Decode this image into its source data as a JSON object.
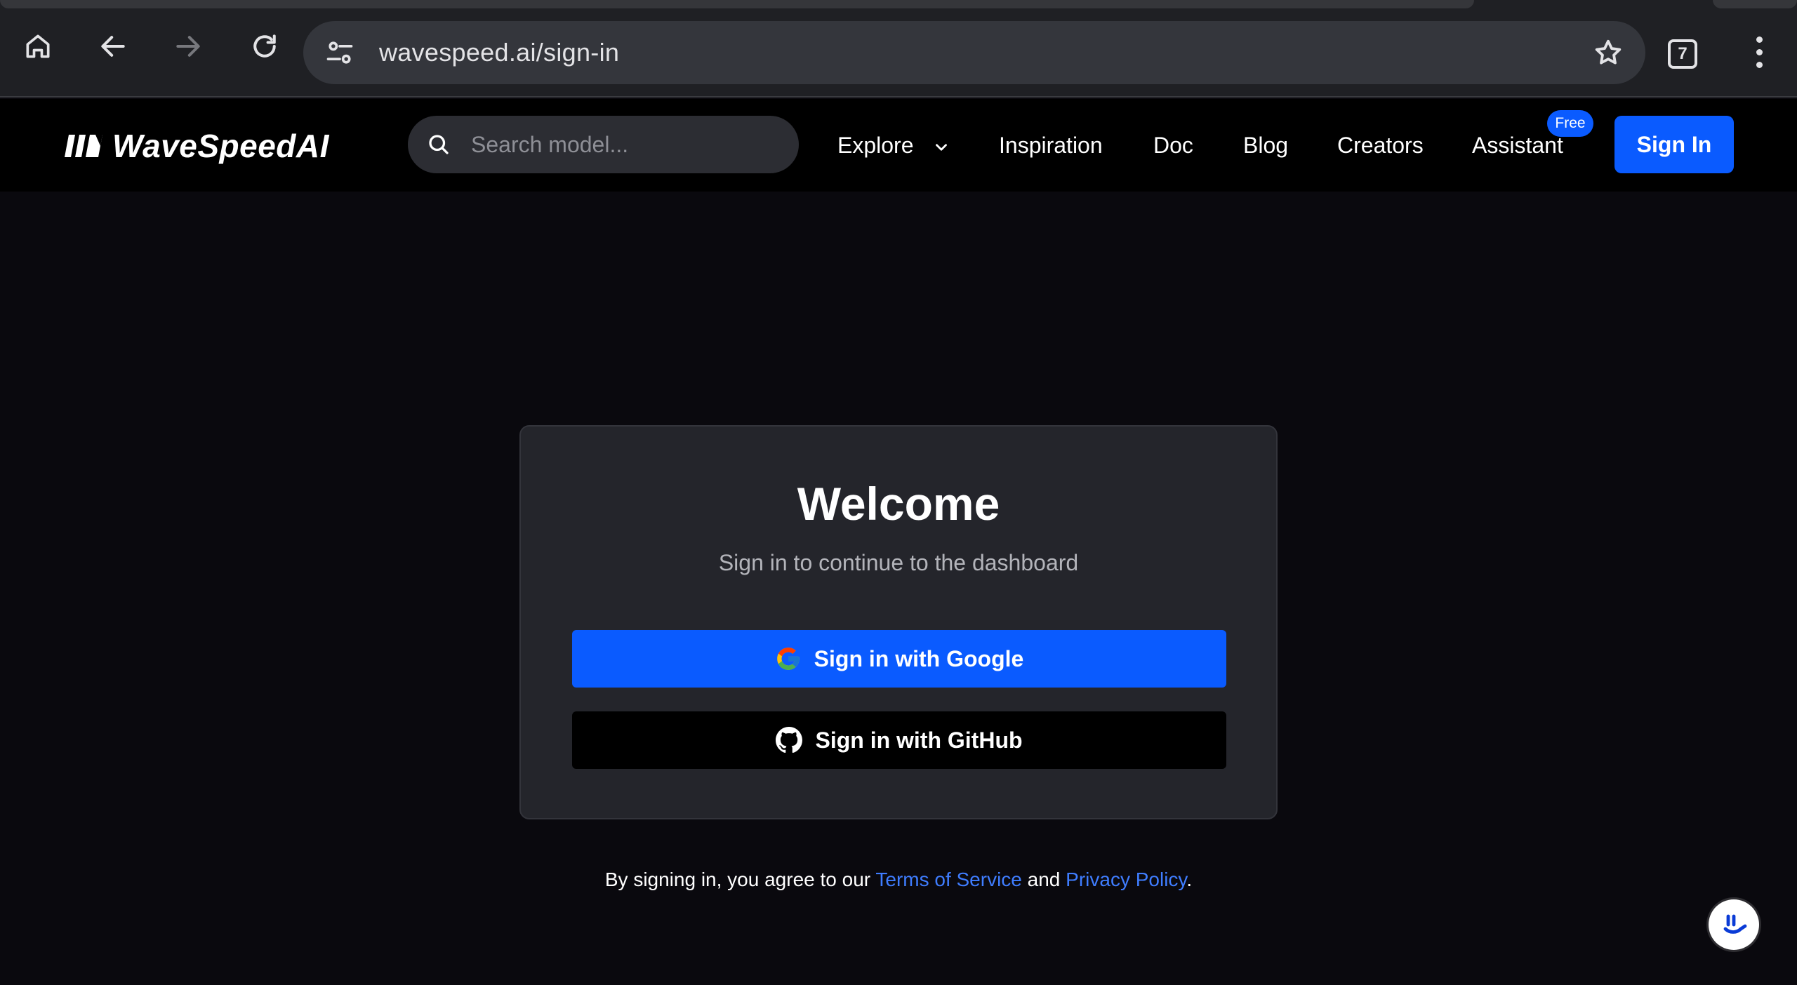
{
  "browser": {
    "url": "wavespeed.ai/sign-in",
    "tab_count": "7"
  },
  "header": {
    "logo_text": "WaveSpeedAI",
    "search_placeholder": "Search model...",
    "nav": {
      "explore": "Explore",
      "inspiration": "Inspiration",
      "doc": "Doc",
      "blog": "Blog",
      "creators": "Creators",
      "assistant": "Assistant",
      "assistant_badge": "Free"
    },
    "sign_in": "Sign In"
  },
  "card": {
    "title": "Welcome",
    "subtitle": "Sign in to continue to the dashboard",
    "google_button": "Sign in with Google",
    "github_button": "Sign in with GitHub"
  },
  "terms": {
    "prefix": "By signing in, you agree to our ",
    "terms_link": "Terms of Service",
    "middle": " and ",
    "privacy_link": "Privacy Policy",
    "suffix": "."
  },
  "colors": {
    "accent": "#0a5bff",
    "page_bg": "#0a090e",
    "card_bg": "#24252b",
    "link": "#3f7dff"
  }
}
